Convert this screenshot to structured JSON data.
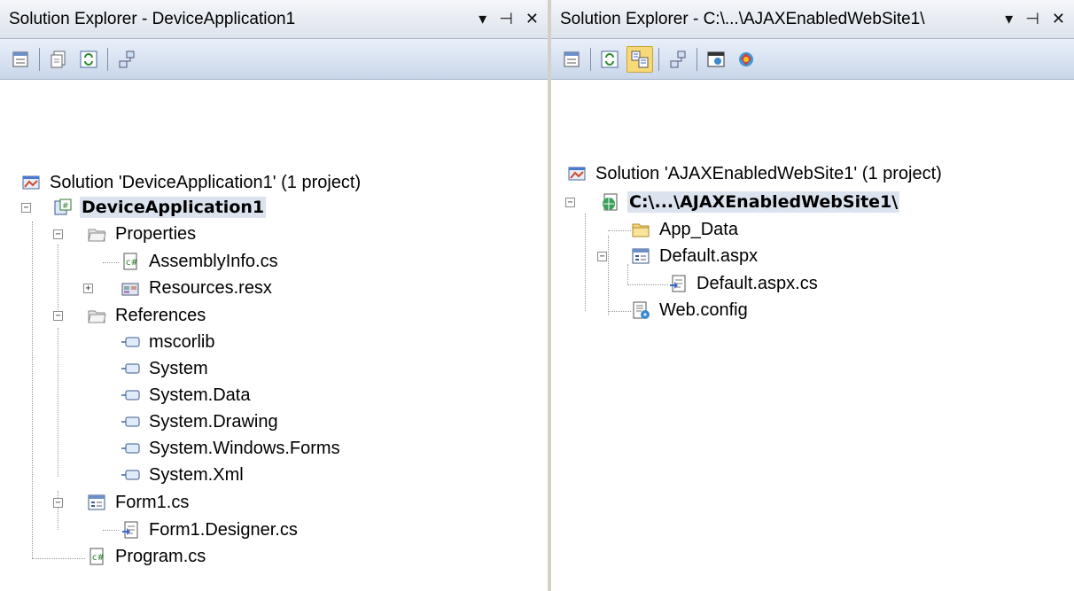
{
  "left": {
    "title": "Solution Explorer - DeviceApplication1",
    "solution": "Solution 'DeviceApplication1' (1 project)",
    "project": "DeviceApplication1",
    "properties": "Properties",
    "assembly_info": "AssemblyInfo.cs",
    "resources": "Resources.resx",
    "references": "References",
    "refs": [
      "mscorlib",
      "System",
      "System.Data",
      "System.Drawing",
      "System.Windows.Forms",
      "System.Xml"
    ],
    "form1": "Form1.cs",
    "form1_designer": "Form1.Designer.cs",
    "program": "Program.cs"
  },
  "right": {
    "title": "Solution Explorer - C:\\...\\AJAXEnabledWebSite1\\",
    "solution": "Solution 'AJAXEnabledWebSite1' (1 project)",
    "project": "C:\\...\\AJAXEnabledWebSite1\\",
    "app_data": "App_Data",
    "default_aspx": "Default.aspx",
    "default_aspx_cs": "Default.aspx.cs",
    "web_config": "Web.config"
  },
  "window_buttons": {
    "dropdown": "▾",
    "pin": "⊣",
    "close": "✕"
  },
  "expand_glyphs": {
    "expanded": "−",
    "collapsed": "+"
  }
}
